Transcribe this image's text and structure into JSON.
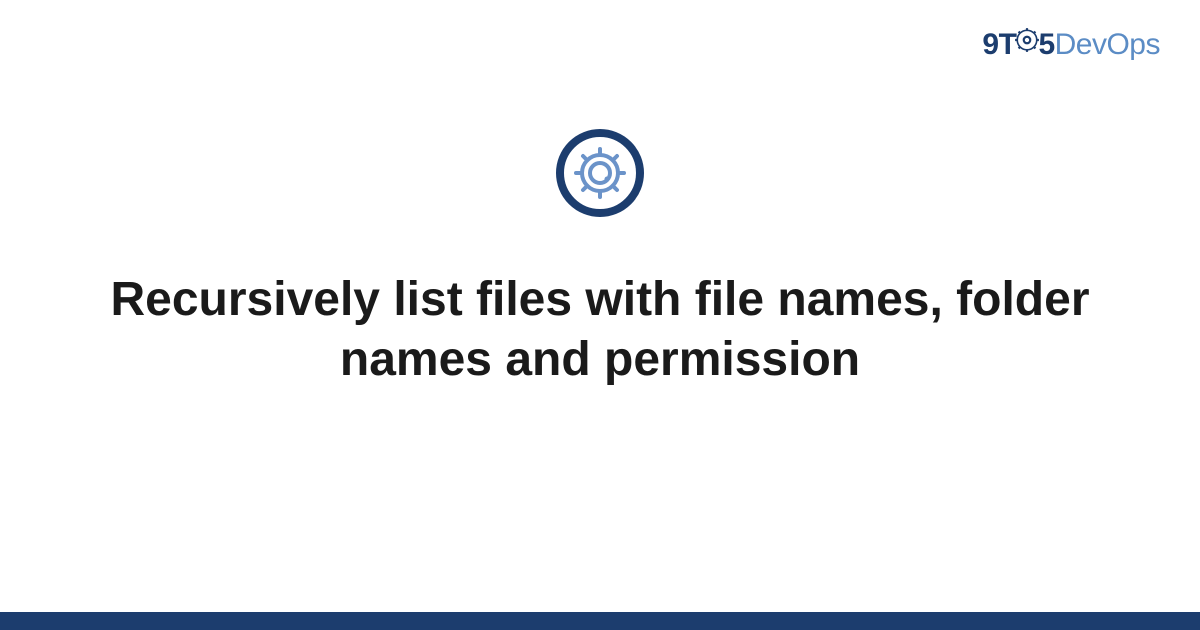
{
  "logo": {
    "prefix": "9T",
    "middle": "5",
    "suffix": "DevOps"
  },
  "hero": {
    "icon": "gear-icon"
  },
  "title": "Recursively list files with file names, folder names and permission",
  "colors": {
    "brand_dark": "#1c3d6e",
    "brand_light": "#5b8cc5",
    "text": "#1a1a1a"
  }
}
